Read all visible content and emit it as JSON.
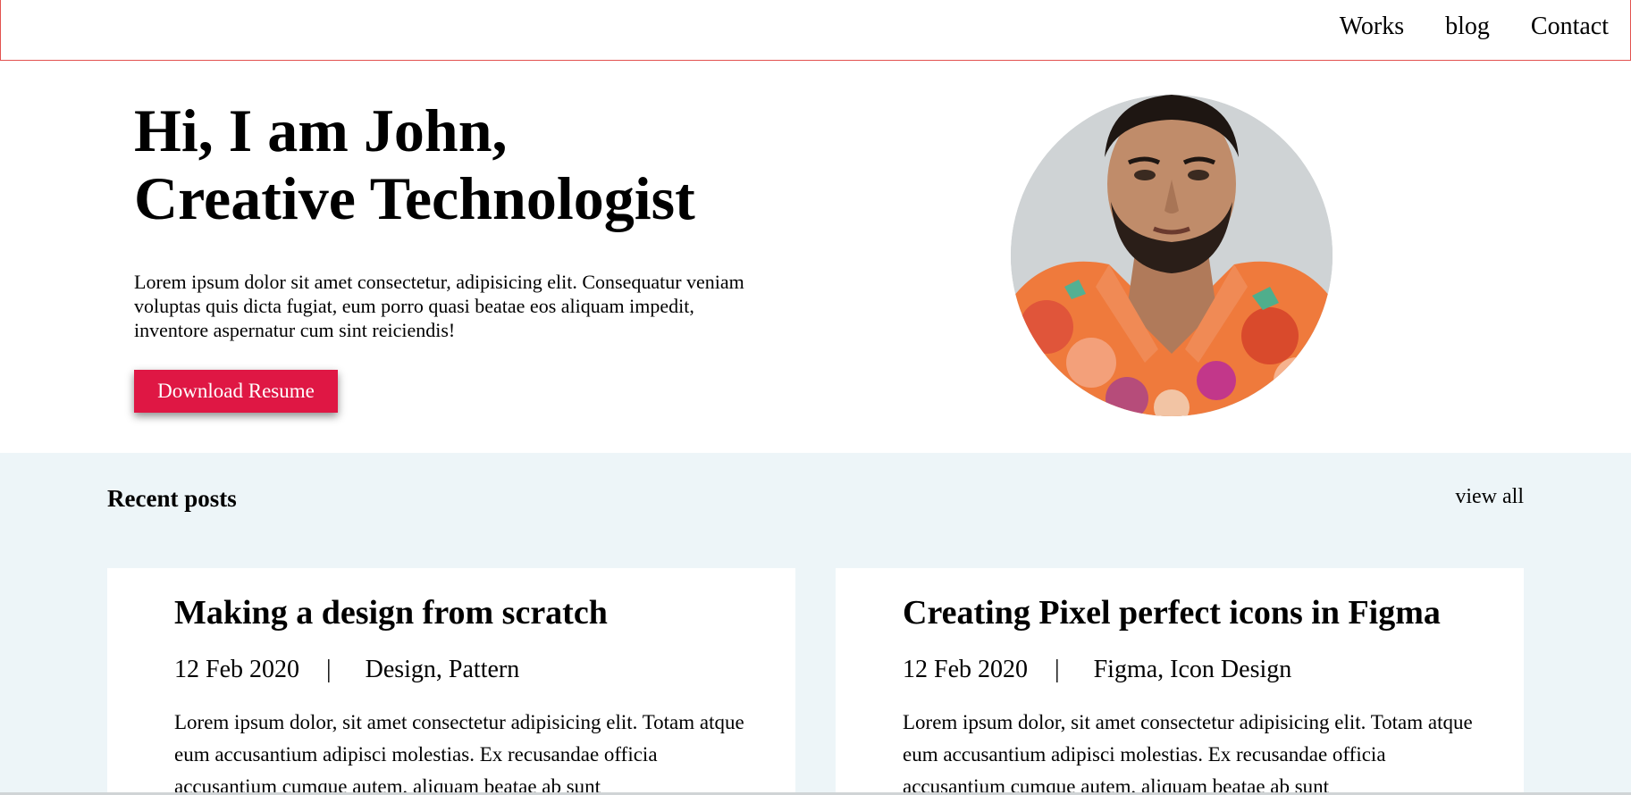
{
  "nav": {
    "items": [
      "Works",
      "blog",
      "Contact"
    ]
  },
  "hero": {
    "title_line1": "Hi, I am John,",
    "title_line2": "Creative Technologist",
    "description": "Lorem ipsum dolor sit amet consectetur, adipisicing elit. Consequatur veniam voluptas quis dicta fugiat, eum porro quasi beatae eos aliquam impedit, inventore aspernatur cum sint reiciendis!",
    "button_label": "Download Resume"
  },
  "posts": {
    "heading": "Recent posts",
    "view_all": "view all",
    "items": [
      {
        "title": "Making a design from scratch",
        "date": "12 Feb 2020",
        "separator": "|",
        "tags": "Design, Pattern",
        "excerpt": "Lorem ipsum dolor, sit amet consectetur adipisicing elit. Totam atque eum accusantium adipisci molestias. Ex recusandae officia accusantium cumque autem, aliquam beatae ab sunt"
      },
      {
        "title": "Creating Pixel perfect icons in Figma",
        "date": "12 Feb 2020",
        "separator": "|",
        "tags": "Figma, Icon Design",
        "excerpt": "Lorem ipsum dolor, sit amet consectetur adipisicing elit. Totam atque eum accusantium adipisci molestias. Ex recusandae officia accusantium cumque autem, aliquam beatae ab sunt"
      }
    ]
  },
  "colors": {
    "accent": "#df1744",
    "header_border": "#e2524f",
    "section_background": "#edf5f8"
  }
}
